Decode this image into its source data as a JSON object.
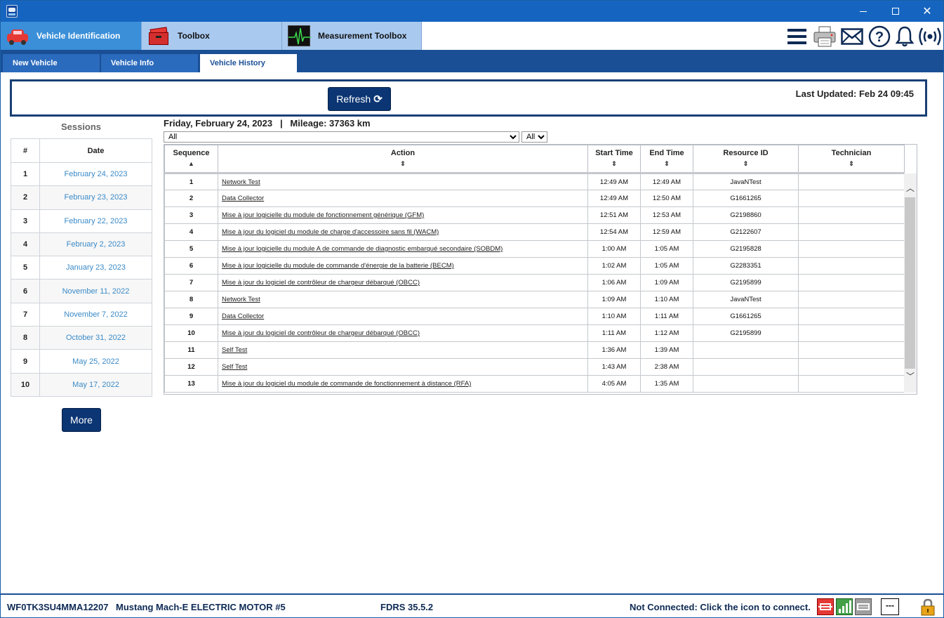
{
  "main_tabs": [
    {
      "label": "Vehicle Identification",
      "icon": "car-icon"
    },
    {
      "label": "Toolbox",
      "icon": "toolbox-icon"
    },
    {
      "label": "Measurement Toolbox",
      "icon": "oscilloscope-icon"
    }
  ],
  "toolbar_icons": [
    "menu-icon",
    "printer-icon",
    "mail-icon",
    "help-icon",
    "bell-icon",
    "wireless-icon"
  ],
  "sub_tabs": [
    {
      "label": "New Vehicle"
    },
    {
      "label": "Vehicle Info"
    },
    {
      "label": "Vehicle History"
    }
  ],
  "refresh": {
    "button_label": "Refresh",
    "last_updated": "Last Updated: Feb 24 09:45"
  },
  "sessions": {
    "title": "Sessions",
    "col_num": "#",
    "col_date": "Date",
    "rows": [
      {
        "num": "1",
        "date": "February 24, 2023"
      },
      {
        "num": "2",
        "date": "February 23, 2023"
      },
      {
        "num": "3",
        "date": "February 22, 2023"
      },
      {
        "num": "4",
        "date": "February 2, 2023"
      },
      {
        "num": "5",
        "date": "January 23, 2023"
      },
      {
        "num": "6",
        "date": "November 11, 2022"
      },
      {
        "num": "7",
        "date": "November 7, 2022"
      },
      {
        "num": "8",
        "date": "October 31, 2022"
      },
      {
        "num": "9",
        "date": "May 25, 2022"
      },
      {
        "num": "10",
        "date": "May 17, 2022"
      }
    ],
    "more_label": "More"
  },
  "history": {
    "heading": "Friday, February 24, 2023   |   Mileage: 37363 km",
    "filter_action": "All",
    "filter_second": "All",
    "columns": [
      "Sequence",
      "Action",
      "Start Time",
      "End Time",
      "Resource ID",
      "Technician"
    ],
    "rows": [
      {
        "seq": "1",
        "action": "Network Test",
        "start": "12:49 AM",
        "end": "12:49 AM",
        "resource": "JavaNTest",
        "tech": ""
      },
      {
        "seq": "2",
        "action": "Data Collector",
        "start": "12:49 AM",
        "end": "12:50 AM",
        "resource": "G1661265",
        "tech": ""
      },
      {
        "seq": "3",
        "action": "Mise à jour logicielle du module de fonctionnement générique (GFM)",
        "start": "12:51 AM",
        "end": "12:53 AM",
        "resource": "G2198860",
        "tech": ""
      },
      {
        "seq": "4",
        "action": "Mise à jour du logiciel du module de charge d'accessoire sans fil (WACM)",
        "start": "12:54 AM",
        "end": "12:59 AM",
        "resource": "G2122607",
        "tech": ""
      },
      {
        "seq": "5",
        "action": "Mise à jour logicielle du module A de commande de diagnostic embarqué secondaire (SOBDM)",
        "start": "1:00 AM",
        "end": "1:05 AM",
        "resource": "G2195828",
        "tech": ""
      },
      {
        "seq": "6",
        "action": "Mise à jour logicielle du module de commande d'énergie de la batterie (BECM)",
        "start": "1:02 AM",
        "end": "1:05 AM",
        "resource": "G2283351",
        "tech": ""
      },
      {
        "seq": "7",
        "action": "Mise à jour du logiciel de contrôleur de chargeur débarqué (OBCC)",
        "start": "1:06 AM",
        "end": "1:09 AM",
        "resource": "G2195899",
        "tech": ""
      },
      {
        "seq": "8",
        "action": "Network Test",
        "start": "1:09 AM",
        "end": "1:10 AM",
        "resource": "JavaNTest",
        "tech": ""
      },
      {
        "seq": "9",
        "action": "Data Collector",
        "start": "1:10 AM",
        "end": "1:11 AM",
        "resource": "G1661265",
        "tech": ""
      },
      {
        "seq": "10",
        "action": "Mise à jour du logiciel de contrôleur de chargeur débarqué (OBCC)",
        "start": "1:11 AM",
        "end": "1:12 AM",
        "resource": "G2195899",
        "tech": ""
      },
      {
        "seq": "11",
        "action": "Self Test",
        "start": "1:36 AM",
        "end": "1:39 AM",
        "resource": "",
        "tech": ""
      },
      {
        "seq": "12",
        "action": "Self Test",
        "start": "1:43 AM",
        "end": "2:38 AM",
        "resource": "",
        "tech": ""
      },
      {
        "seq": "13",
        "action": "Mise à jour du logiciel du module de commande de fonctionnement à distance (RFA)",
        "start": "4:05 AM",
        "end": "1:35 AM",
        "resource": "",
        "tech": ""
      }
    ]
  },
  "status_bar": {
    "vin": "WF0TK3SU4MMA12207",
    "model": "Mustang Mach-E ELECTRIC MOTOR #5",
    "version": "FDRS 35.5.2",
    "connection": "Not Connected: Click the icon to connect.",
    "dash_label": "---"
  }
}
